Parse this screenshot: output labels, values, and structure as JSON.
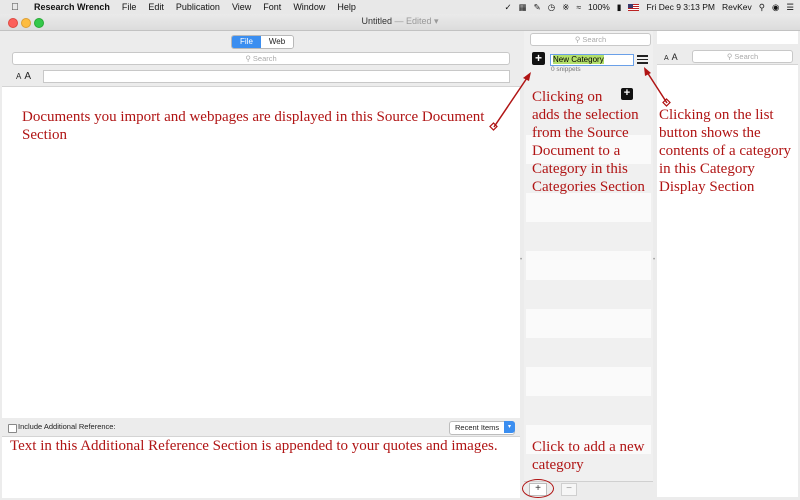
{
  "menubar": {
    "apple": "",
    "app_name": "Research Wrench",
    "items": [
      "File",
      "Edit",
      "Publication",
      "View",
      "Font",
      "Window",
      "Help"
    ],
    "battery": "100%",
    "datetime": "Fri Dec 9  3:13 PM",
    "user": "RevKev"
  },
  "window": {
    "title": "Untitled",
    "edited": "— Edited ▾"
  },
  "source": {
    "tabs": [
      "File",
      "Web"
    ],
    "active_tab": "File",
    "search_placeholder": "Search",
    "font_small": "A",
    "font_large": "A",
    "annotation": "Documents you import and webpages are displayed in this Source Document Section"
  },
  "additional_reference": {
    "checkbox_label": "Include Additional Reference:",
    "dropdown_value": "Recent Items",
    "annotation": "Text in this Additional Reference Section is appended to your quotes and images."
  },
  "categories": {
    "search_placeholder": "Search",
    "category_name": "New Category",
    "snippet_count": "0 snippets",
    "add_icon_glyph": "+",
    "annotation_add": "Clicking on\nadds the selection from the Source Document to a Category in this Categories Section",
    "annotation_add_first": "Clicking on",
    "annotation_add_rest": "adds the selection from the Source Document to a Category in this Categories Section",
    "annotation_new": "Click to add a new category",
    "add_button": "+",
    "remove_button": "−"
  },
  "display": {
    "search_placeholder": "Search",
    "font_small": "A",
    "font_large": "A",
    "annotation": "Clicking on the list button shows the contents of a category in this Category Display Section"
  },
  "colors": {
    "annotation": "#b01414",
    "accent": "#3b8ef0",
    "highlight": "#b3e06b"
  }
}
